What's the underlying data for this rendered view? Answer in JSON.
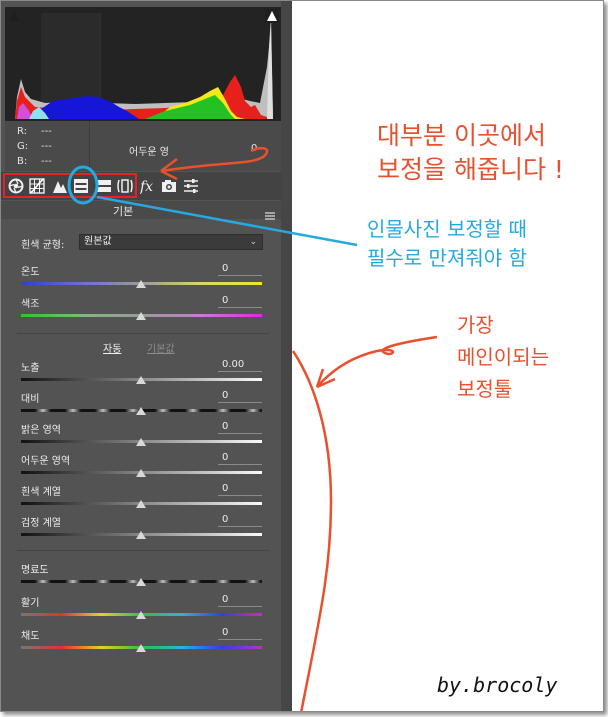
{
  "histogram": {
    "readout": {
      "r_label": "R:",
      "r_value": "---",
      "g_label": "G:",
      "g_value": "---",
      "b_label": "B:",
      "b_value": "---",
      "name": "어두운 영",
      "value": "0"
    }
  },
  "toolbar": {
    "icons": [
      "basic-panel-icon",
      "tone-curve-icon",
      "detail-icon",
      "hsl-icon",
      "split-toning-icon",
      "lens-corrections-icon",
      "fx-icon",
      "camera-calibration-icon",
      "presets-icon"
    ]
  },
  "panel": {
    "title": "기본",
    "white_balance": {
      "label": "흰색 균형:",
      "value": "원본값"
    },
    "sliders_top": [
      {
        "label": "온도",
        "value": "0"
      },
      {
        "label": "색조",
        "value": "0"
      }
    ],
    "auto": "자동",
    "default": "기본값",
    "sliders_tone": [
      {
        "label": "노출",
        "value": "0.00"
      },
      {
        "label": "대비",
        "value": "0"
      },
      {
        "label": "밝은 영역",
        "value": "0"
      },
      {
        "label": "어두운 영역",
        "value": "0"
      },
      {
        "label": "흰색 계열",
        "value": "0"
      },
      {
        "label": "검정 계열",
        "value": "0"
      }
    ],
    "sliders_presence": [
      {
        "label": "명료도",
        "value": "0"
      },
      {
        "label": "활기",
        "value": "0"
      },
      {
        "label": "채도",
        "value": "0"
      }
    ]
  },
  "annotations": {
    "note1_line1": "대부분 이곳에서",
    "note1_line2": "보정을 해줍니다 !",
    "note2_line1": "인물사진 보정할 때",
    "note2_line2": "필수로 만져줘야 함",
    "note3_line1": "가장",
    "note3_line2": "메인이되는",
    "note3_line3": "보정툴",
    "signature": "by.brocoly"
  },
  "colors": {
    "panel": "#535353",
    "red_annotation": "#e8502e",
    "blue_annotation": "#26a9e0",
    "tool_outline": "#e8202a"
  }
}
